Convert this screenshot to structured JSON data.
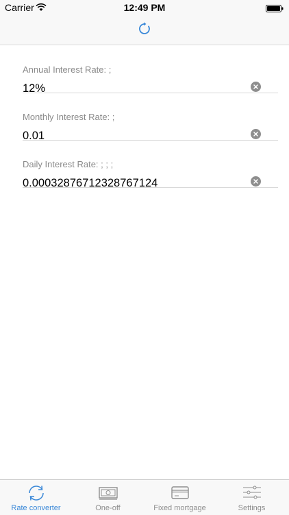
{
  "status_bar": {
    "carrier": "Carrier",
    "time": "12:49 PM"
  },
  "nav_bar": {
    "refresh_icon": "refresh-icon"
  },
  "fields": [
    {
      "label": "Annual Interest Rate: ;",
      "value": "12%"
    },
    {
      "label": "Monthly Interest Rate: ;",
      "value": "0.01"
    },
    {
      "label": "Daily Interest Rate: ; ; ;",
      "value": "0.00032876712328767124"
    }
  ],
  "tab_bar": {
    "tabs": [
      {
        "label": "Rate converter",
        "icon": "sync-icon",
        "active": true
      },
      {
        "label": "One-off",
        "icon": "cash-icon",
        "active": false
      },
      {
        "label": "Fixed mortgage",
        "icon": "card-icon",
        "active": false
      },
      {
        "label": "Settings",
        "icon": "sliders-icon",
        "active": false
      }
    ]
  },
  "colors": {
    "accent": "#3a88d8",
    "inactive": "#8e8e8e",
    "bar_background": "#f8f8f8"
  }
}
